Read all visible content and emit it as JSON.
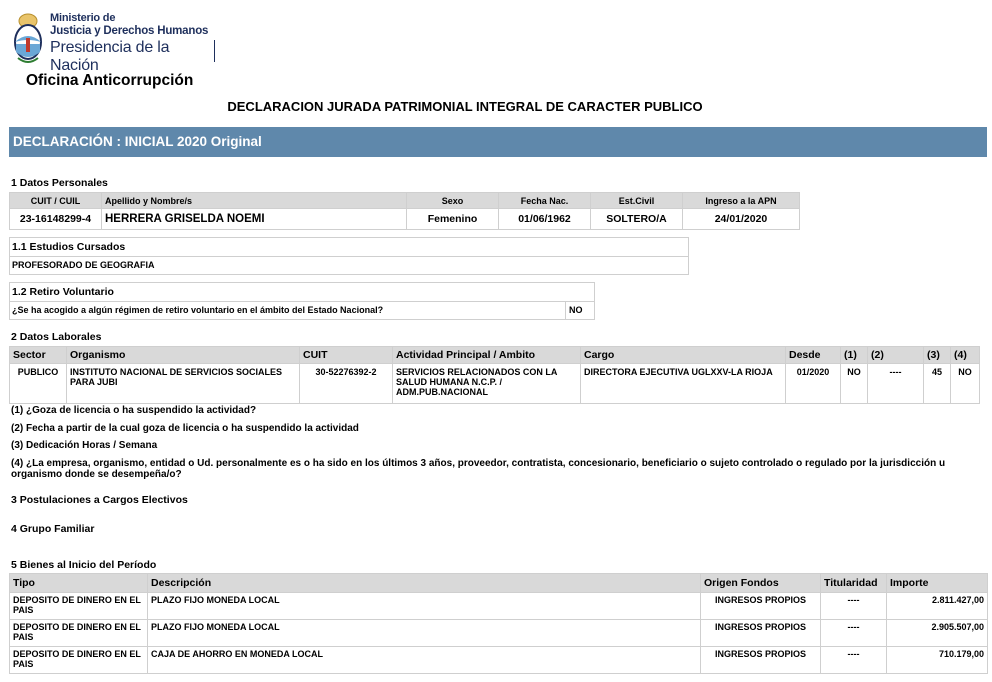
{
  "header": {
    "logo_line1": "Ministerio de",
    "logo_line2": "Justicia y Derechos Humanos",
    "logo_line3": "Presidencia de la Nación",
    "office": "Oficina Anticorrupción",
    "doc_title": "DECLARACION JURADA PATRIMONIAL INTEGRAL DE CARACTER PUBLICO",
    "declaration": "DECLARACIÓN :  INICIAL 2020 Original"
  },
  "colors": {
    "bar": "#5f88ab",
    "header_cell": "#d9d9d9",
    "logo_blue": "#1e2f5c"
  },
  "personal": {
    "title": "1 Datos Personales",
    "headers": [
      "CUIT / CUIL",
      "Apellido y Nombre/s",
      "Sexo",
      "Fecha Nac.",
      "Est.Civil",
      "Ingreso a la APN"
    ],
    "values": [
      "23-16148299-4",
      "HERRERA GRISELDA NOEMI",
      "Femenino",
      "01/06/1962",
      "SOLTERO/A",
      "24/01/2020"
    ]
  },
  "studies": {
    "title": "1.1 Estudios Cursados",
    "value": "PROFESORADO DE GEOGRAFIA"
  },
  "retirement": {
    "title": "1.2 Retiro Voluntario",
    "question": "¿Se ha acogido a algún régimen de retiro voluntario en el ámbito del Estado Nacional?",
    "answer": "NO"
  },
  "labor": {
    "title": "2 Datos Laborales",
    "headers": [
      "Sector",
      "Organismo",
      "CUIT",
      "Actividad Principal / Ambito",
      "Cargo",
      "Desde",
      "(1)",
      "(2)",
      "(3)",
      "(4)"
    ],
    "row": [
      "PUBLICO",
      "INSTITUTO NACIONAL DE SERVICIOS SOCIALES PARA JUBI",
      "30-52276392-2",
      "SERVICIOS RELACIONADOS CON LA SALUD HUMANA N.C.P. / ADM.PUB.NACIONAL",
      "DIRECTORA EJECUTIVA UGLXXV-LA RIOJA",
      "01/2020",
      "NO",
      "----",
      "45",
      "NO"
    ],
    "notes": [
      "(1) ¿Goza de licencia o ha suspendido la actividad?",
      "(2) Fecha a partir de la cual goza de licencia o ha suspendido la actividad",
      "(3) Dedicación Horas / Semana",
      "(4) ¿La empresa, organismo, entidad o Ud. personalmente es o ha sido en los últimos 3 años, proveedor, contratista, concesionario, beneficiario o sujeto controlado o regulado por la jurisdicción u organismo donde se desempeña/o?"
    ]
  },
  "elections": {
    "title": "3 Postulaciones a Cargos Electivos"
  },
  "family": {
    "title": "4 Grupo Familiar"
  },
  "assets": {
    "title": "5 Bienes al Inicio del Período",
    "headers": [
      "Tipo",
      "Descripción",
      "Origen Fondos",
      "Titularidad",
      "Importe"
    ],
    "rows": [
      [
        "DEPOSITO DE DINERO EN EL PAIS",
        "PLAZO FIJO MONEDA LOCAL",
        "INGRESOS PROPIOS",
        "----",
        "2.811.427,00"
      ],
      [
        "DEPOSITO DE DINERO EN EL PAIS",
        "PLAZO FIJO MONEDA LOCAL",
        "INGRESOS PROPIOS",
        "----",
        "2.905.507,00"
      ],
      [
        "DEPOSITO DE DINERO EN EL PAIS",
        "CAJA DE AHORRO EN MONEDA LOCAL",
        "INGRESOS PROPIOS",
        "----",
        "710.179,00"
      ]
    ]
  }
}
